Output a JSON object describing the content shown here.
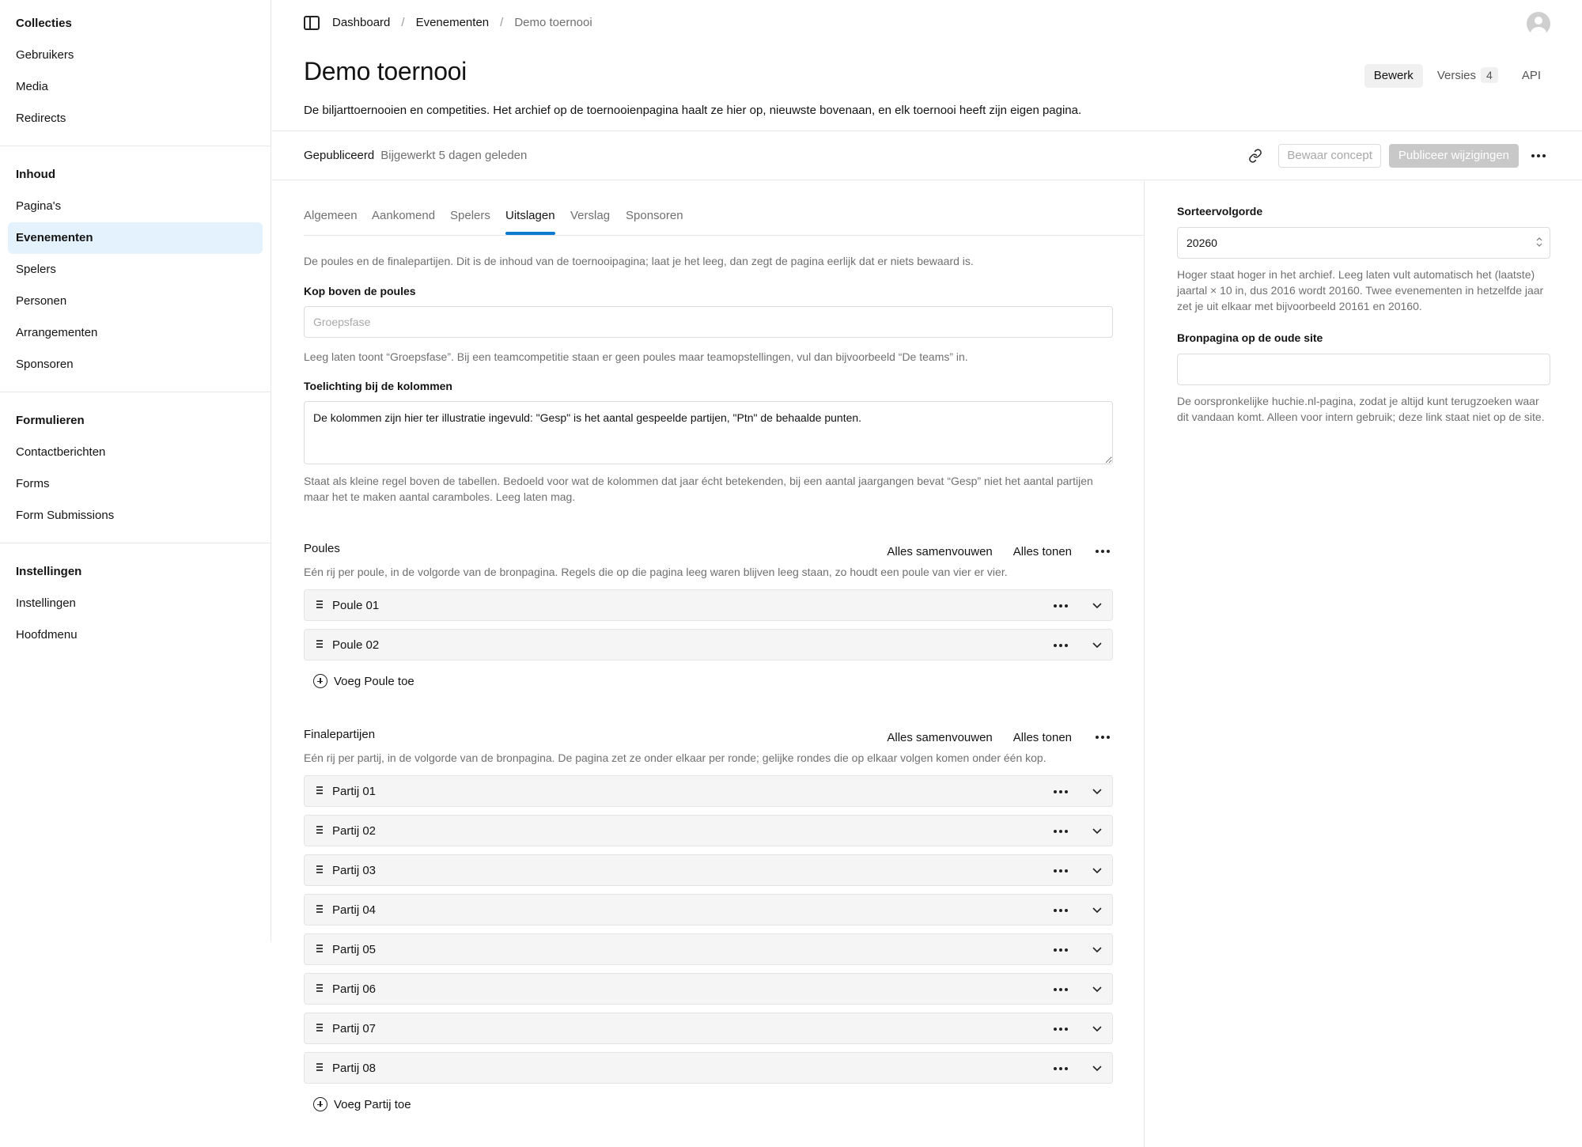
{
  "sidebar": {
    "groups": [
      {
        "title": "Collecties",
        "items": [
          "Gebruikers",
          "Media",
          "Redirects"
        ]
      },
      {
        "title": "Inhoud",
        "items": [
          "Pagina's",
          "Evenementen",
          "Spelers",
          "Personen",
          "Arrangementen",
          "Sponsoren"
        ]
      },
      {
        "title": "Formulieren",
        "items": [
          "Contactberichten",
          "Forms",
          "Form Submissions"
        ]
      },
      {
        "title": "Instellingen",
        "items": [
          "Instellingen",
          "Hoofdmenu"
        ]
      }
    ],
    "active_item": "Evenementen"
  },
  "breadcrumb": [
    "Dashboard",
    "Evenementen",
    "Demo toernooi"
  ],
  "page": {
    "title": "Demo toernooi",
    "description": "De biljarttoernooien en competities. Het archief op de toernooienpagina haalt ze hier op, nieuwste bovenaan, en elk toernooi heeft zijn eigen pagina."
  },
  "doc_tabs": {
    "edit": "Bewerk",
    "versions": "Versies",
    "versions_count": "4",
    "api": "API"
  },
  "status": {
    "state": "Gepubliceerd",
    "updated": "Bijgewerkt 5 dagen geleden",
    "save_draft": "Bewaar concept",
    "publish": "Publiceer wijzigingen"
  },
  "tabs": [
    "Algemeen",
    "Aankomend",
    "Spelers",
    "Uitslagen",
    "Verslag",
    "Sponsoren"
  ],
  "active_tab": "Uitslagen",
  "results": {
    "intro": "De poules en de finalepartijen. Dit is de inhoud van de toernooipagina; laat je het leeg, dan zegt de pagina eerlijk dat er niets bewaard is.",
    "poule_heading": {
      "label": "Kop boven de poules",
      "placeholder": "Groepsfase",
      "value": "",
      "help": "Leeg laten toont “Groepsfase”. Bij een teamcompetitie staan er geen poules maar teamopstellingen, vul dan bijvoorbeeld “De teams” in."
    },
    "columns_note": {
      "label": "Toelichting bij de kolommen",
      "value": "De kolommen zijn hier ter illustratie ingevuld: \"Gesp\" is het aantal gespeelde partijen, \"Ptn\" de behaalde punten.",
      "help": "Staat als kleine regel boven de tabellen. Bedoeld voor wat de kolommen dat jaar écht betekenden, bij een aantal jaargangen bevat “Gesp” niet het aantal partijen maar het te maken aantal caramboles. Leeg laten mag."
    },
    "poules": {
      "title": "Poules",
      "collapse_all": "Alles samenvouwen",
      "show_all": "Alles tonen",
      "help": "Eén rij per poule, in de volgorde van de bronpagina. Regels die op die pagina leeg waren blijven leeg staan, zo houdt een poule van vier er vier.",
      "rows": [
        "Poule 01",
        "Poule 02"
      ],
      "add_label": "Voeg Poule toe"
    },
    "finals": {
      "title": "Finalepartijen",
      "collapse_all": "Alles samenvouwen",
      "show_all": "Alles tonen",
      "help": "Eén rij per partij, in de volgorde van de bronpagina. De pagina zet ze onder elkaar per ronde; gelijke rondes die op elkaar volgen komen onder één kop.",
      "rows": [
        "Partij 01",
        "Partij 02",
        "Partij 03",
        "Partij 04",
        "Partij 05",
        "Partij 06",
        "Partij 07",
        "Partij 08"
      ],
      "add_label": "Voeg Partij toe"
    }
  },
  "side": {
    "sort": {
      "label": "Sorteervolgorde",
      "value": "20260",
      "help": "Hoger staat hoger in het archief. Leeg laten vult automatisch het (laatste) jaartal × 10 in, dus 2016 wordt 20160. Twee evenementen in hetzelfde jaar zet je uit elkaar met bijvoorbeeld 20161 en 20160."
    },
    "source": {
      "label": "Bronpagina op de oude site",
      "value": "",
      "help": "De oorspronkelijke huchie.nl-pagina, zodat je altijd kunt terugzoeken waar dit vandaan komt. Alleen voor intern gebruik; deze link staat niet op de site."
    }
  }
}
